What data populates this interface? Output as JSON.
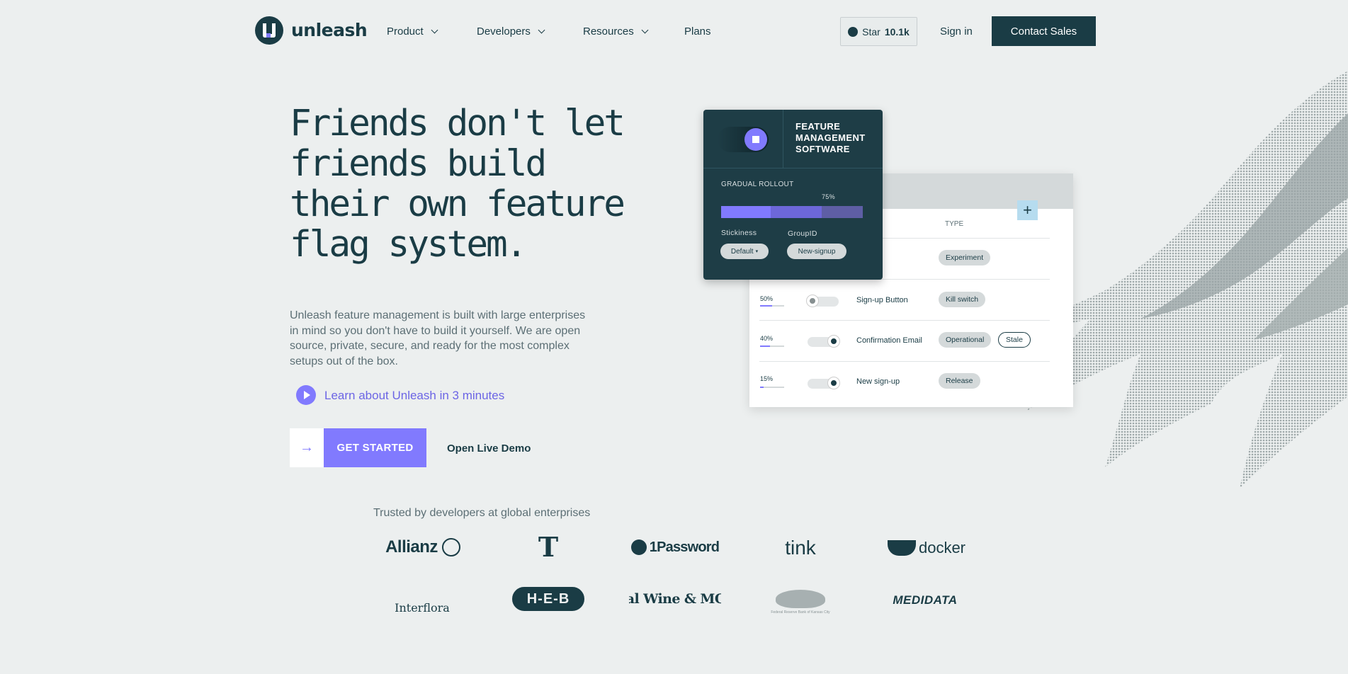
{
  "nav": {
    "brand": "unleash",
    "items": [
      {
        "label": "Product",
        "has_dropdown": true
      },
      {
        "label": "Developers",
        "has_dropdown": true
      },
      {
        "label": "Resources",
        "has_dropdown": true
      },
      {
        "label": "Plans",
        "has_dropdown": false
      }
    ],
    "github": {
      "label": "Star",
      "count": "10.1k"
    },
    "signin": "Sign in",
    "contact": "Contact Sales"
  },
  "hero": {
    "title": "Friends don't let friends build their own feature flag system.",
    "description": "Unleash feature management is built with large enterprises in mind so you don't have to build it yourself. We are open source, private, secure, and ready for the most complex setups out of the box.",
    "learn_link": "Learn about Unleash in 3 minutes",
    "cta_primary": "GET STARTED",
    "cta_secondary": "Open Live Demo"
  },
  "illustration": {
    "feature_card": {
      "title": "FEATURE MANAGEMENT SOFTWARE",
      "rollout_label": "GRADUAL ROLLOUT",
      "rollout_marker": "75%",
      "stickiness_label": "Stickiness",
      "stickiness_value": "Default",
      "groupid_label": "GroupID",
      "groupid_value": "New-signup"
    },
    "table": {
      "type_header": "TYPE",
      "rows": [
        {
          "percent": "",
          "name": "",
          "type": "Experiment",
          "enabled": null,
          "fill": 0
        },
        {
          "percent": "50%",
          "name": "Sign-up Button",
          "type": "Kill switch",
          "enabled": false,
          "fill": 0.5
        },
        {
          "percent": "40%",
          "name": "Confirmation Email",
          "type": "Operational",
          "extra_tag": "Stale",
          "enabled": true,
          "fill": 0.4
        },
        {
          "percent": "15%",
          "name": "New sign-up",
          "type": "Release",
          "enabled": true,
          "fill": 0.15
        }
      ]
    }
  },
  "trusted": {
    "heading": "Trusted by developers at global enterprises",
    "logos": [
      "Allianz",
      "T",
      "1Password",
      "tink",
      "docker",
      "Interflora",
      "H-E-B",
      "Total Wine & MORE",
      "Federal Reserve Bank of Kansas City",
      "MEDIDATA"
    ]
  },
  "colors": {
    "primary": "#1a3c45",
    "accent": "#817afe",
    "background": "#ecefef"
  }
}
